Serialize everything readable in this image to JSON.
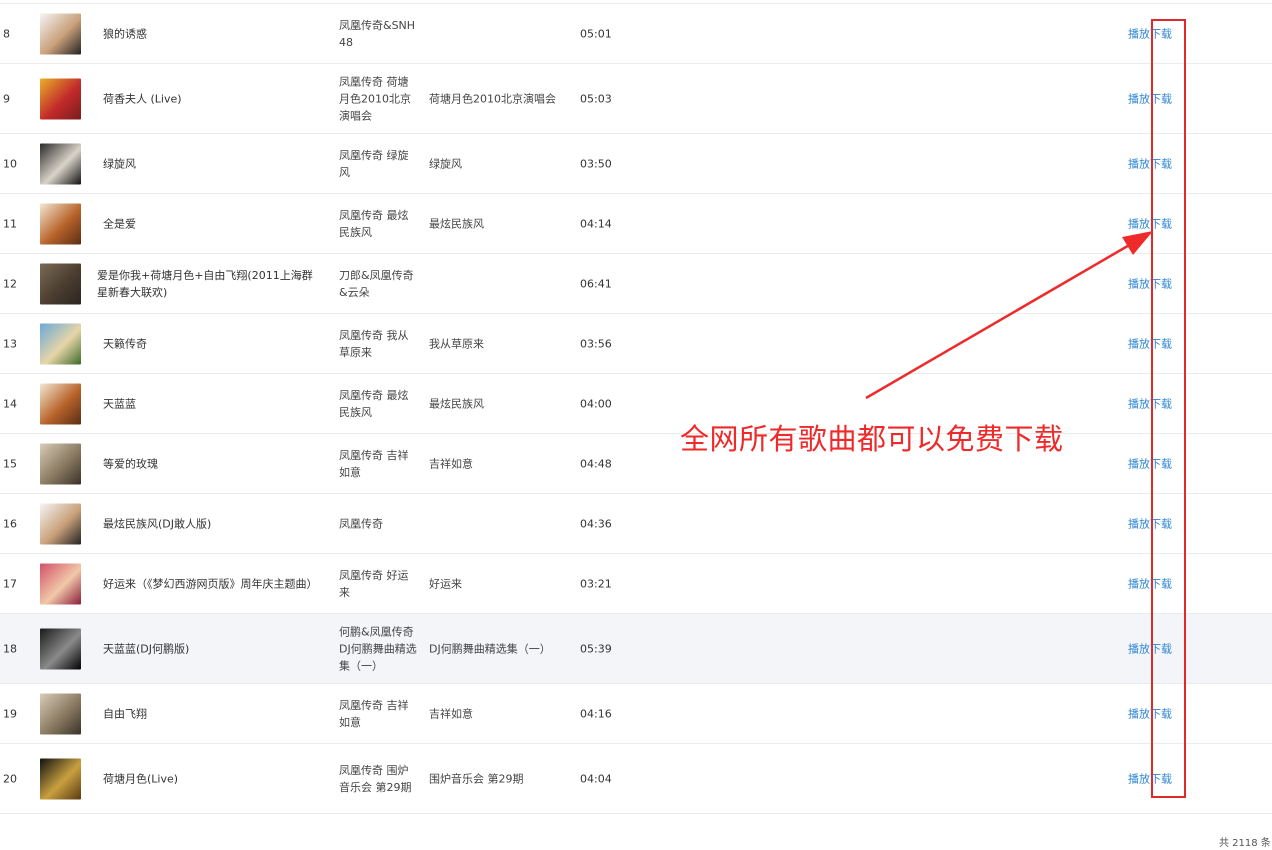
{
  "songs": [
    {
      "index": "8",
      "title": "狼的诱惑",
      "artist": "凤凰传奇&SNH48",
      "album": "",
      "duration": "05:01",
      "cover_colors": [
        "#f5f5f5",
        "#c9a07a",
        "#222"
      ],
      "play_label": "播放",
      "download_label": "下载"
    },
    {
      "index": "9",
      "title": "荷香夫人 (Live)",
      "artist": "凤凰传奇 荷塘月色2010北京演唱会",
      "album": "荷塘月色2010北京演唱会",
      "duration": "05:03",
      "cover_colors": [
        "#e8b02a",
        "#c22a2a",
        "#7a1d1d"
      ],
      "play_label": "播放",
      "download_label": "下载"
    },
    {
      "index": "10",
      "title": "绿旋风",
      "artist": "凤凰传奇 绿旋风",
      "album": "绿旋风",
      "duration": "03:50",
      "cover_colors": [
        "#2a2a2a",
        "#d9d3c9",
        "#111"
      ],
      "play_label": "播放",
      "download_label": "下载"
    },
    {
      "index": "11",
      "title": "全是爱",
      "artist": "凤凰传奇 最炫民族风",
      "album": "最炫民族风",
      "duration": "04:14",
      "cover_colors": [
        "#f2e8d2",
        "#b8632a",
        "#5a2e16"
      ],
      "play_label": "播放",
      "download_label": "下载"
    },
    {
      "index": "12",
      "title": "爱是你我+荷塘月色+自由飞翔(2011上海群星新春大联欢)",
      "artist": "刀郎&凤凰传奇&云朵",
      "album": "",
      "duration": "06:41",
      "cover_colors": [
        "#7a6a55",
        "#4a3d30",
        "#2b2520"
      ],
      "play_label": "播放",
      "download_label": "下载"
    },
    {
      "index": "13",
      "title": "天籁传奇",
      "artist": "凤凰传奇 我从草原来",
      "album": "我从草原来",
      "duration": "03:56",
      "cover_colors": [
        "#6aa8d8",
        "#e6d6a8",
        "#3d6a2a"
      ],
      "play_label": "播放",
      "download_label": "下载"
    },
    {
      "index": "14",
      "title": "天蓝蓝",
      "artist": "凤凰传奇 最炫民族风",
      "album": "最炫民族风",
      "duration": "04:00",
      "cover_colors": [
        "#f2e8d2",
        "#b8632a",
        "#5a2e16"
      ],
      "play_label": "播放",
      "download_label": "下载"
    },
    {
      "index": "15",
      "title": "等爱的玫瑰",
      "artist": "凤凰传奇 吉祥如意",
      "album": "吉祥如意",
      "duration": "04:48",
      "cover_colors": [
        "#d8cdb8",
        "#8a7a62",
        "#3a3228"
      ],
      "play_label": "播放",
      "download_label": "下载"
    },
    {
      "index": "16",
      "title": "最炫民族风(DJ敢人版)",
      "artist": "凤凰传奇",
      "album": "",
      "duration": "04:36",
      "cover_colors": [
        "#f5f5f5",
        "#c9a07a",
        "#222"
      ],
      "play_label": "播放",
      "download_label": "下载"
    },
    {
      "index": "17",
      "title": "好运来（《梦幻西游网页版》周年庆主题曲）",
      "artist": "凤凰传奇 好运来",
      "album": "好运来",
      "duration": "03:21",
      "cover_colors": [
        "#d2506a",
        "#f0c8a8",
        "#8a1d3a"
      ],
      "play_label": "播放",
      "download_label": "下载"
    },
    {
      "index": "18",
      "title": "天蓝蓝(DJ何鹏版)",
      "artist": "何鹏&凤凰传奇 DJ何鹏舞曲精选集（一）",
      "album": "DJ何鹏舞曲精选集（一）",
      "duration": "05:39",
      "cover_colors": [
        "#1a1a1a",
        "#8a8a8a",
        "#000"
      ],
      "play_label": "播放",
      "download_label": "下载"
    },
    {
      "index": "19",
      "title": "自由飞翔",
      "artist": "凤凰传奇 吉祥如意",
      "album": "吉祥如意",
      "duration": "04:16",
      "cover_colors": [
        "#d8cdb8",
        "#8a7a62",
        "#3a3228"
      ],
      "play_label": "播放",
      "download_label": "下载"
    },
    {
      "index": "20",
      "title": "荷塘月色(Live)",
      "artist": "凤凰传奇 围炉音乐会 第29期",
      "album": "围炉音乐会 第29期",
      "duration": "04:04",
      "cover_colors": [
        "#111",
        "#c8a040",
        "#5a3a10"
      ],
      "play_label": "播放",
      "download_label": "下载"
    }
  ],
  "footer": {
    "total_label": "共 2118 条"
  },
  "annotation": {
    "text": "全网所有歌曲都可以免费下载",
    "color": "#ee2a2a"
  }
}
